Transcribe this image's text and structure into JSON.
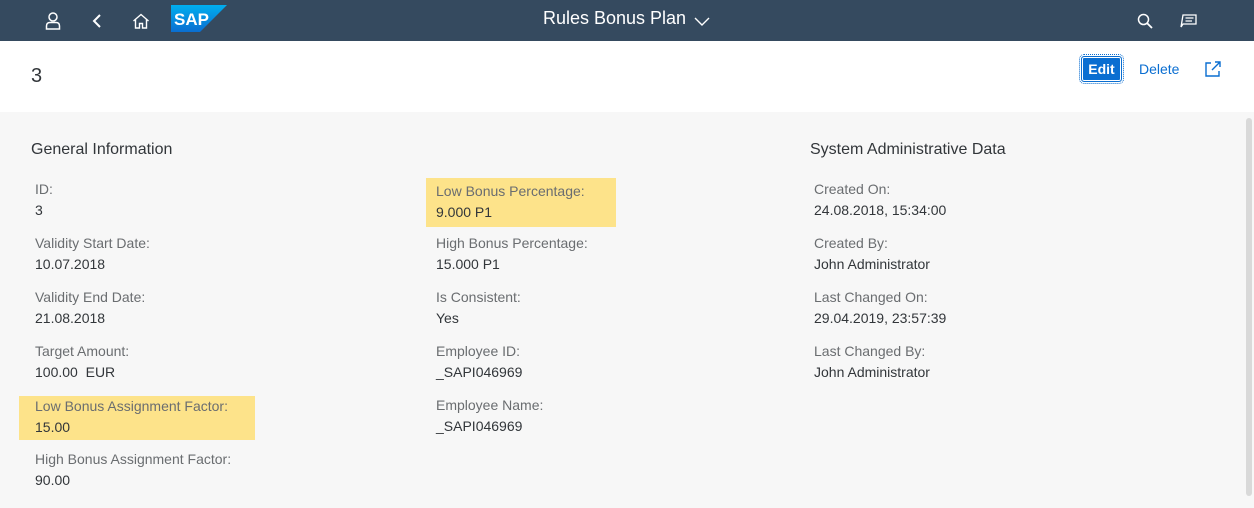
{
  "shell": {
    "title": "Rules Bonus Plan",
    "logo_text": "SAP",
    "icons": [
      "user-icon",
      "back-icon",
      "home-icon",
      "search-icon",
      "notifications-icon"
    ],
    "bar_color": "#354a5f"
  },
  "header": {
    "object_title": "3",
    "edit_label": "Edit",
    "delete_label": "Delete",
    "accent_color": "#0a6ed1"
  },
  "general": {
    "section_title": "General Information",
    "col1": [
      {
        "label": "ID:",
        "value": "3",
        "highlight": false
      },
      {
        "label": "Validity Start Date:",
        "value": "10.07.2018",
        "highlight": false
      },
      {
        "label": "Validity End Date:",
        "value": "21.08.2018",
        "highlight": false
      },
      {
        "label": "Target Amount:",
        "value": "100.00  EUR",
        "highlight": false
      },
      {
        "label": "Low Bonus Assignment Factor:",
        "value": "15.00",
        "highlight": true
      },
      {
        "label": "High Bonus Assignment Factor:",
        "value": "90.00",
        "highlight": false
      }
    ],
    "col2": [
      {
        "label": "Low Bonus Percentage:",
        "value": "9.000 P1",
        "highlight": true
      },
      {
        "label": "High Bonus Percentage:",
        "value": "15.000 P1",
        "highlight": false
      },
      {
        "label": "Is Consistent:",
        "value": "Yes",
        "highlight": false
      },
      {
        "label": "Employee ID:",
        "value": "_SAPI046969",
        "highlight": false
      },
      {
        "label": "Employee Name:",
        "value": "_SAPI046969",
        "highlight": false
      }
    ]
  },
  "admin": {
    "section_title": "System Administrative Data",
    "fields": [
      {
        "label": "Created On:",
        "value": "24.08.2018, 15:34:00",
        "highlight": false
      },
      {
        "label": "Created By:",
        "value": "John Administrator",
        "highlight": false
      },
      {
        "label": "Last Changed On:",
        "value": "29.04.2019, 23:57:39",
        "highlight": false
      },
      {
        "label": "Last Changed By:",
        "value": "John Administrator",
        "highlight": false
      }
    ]
  },
  "highlight_color": "#fde38a"
}
